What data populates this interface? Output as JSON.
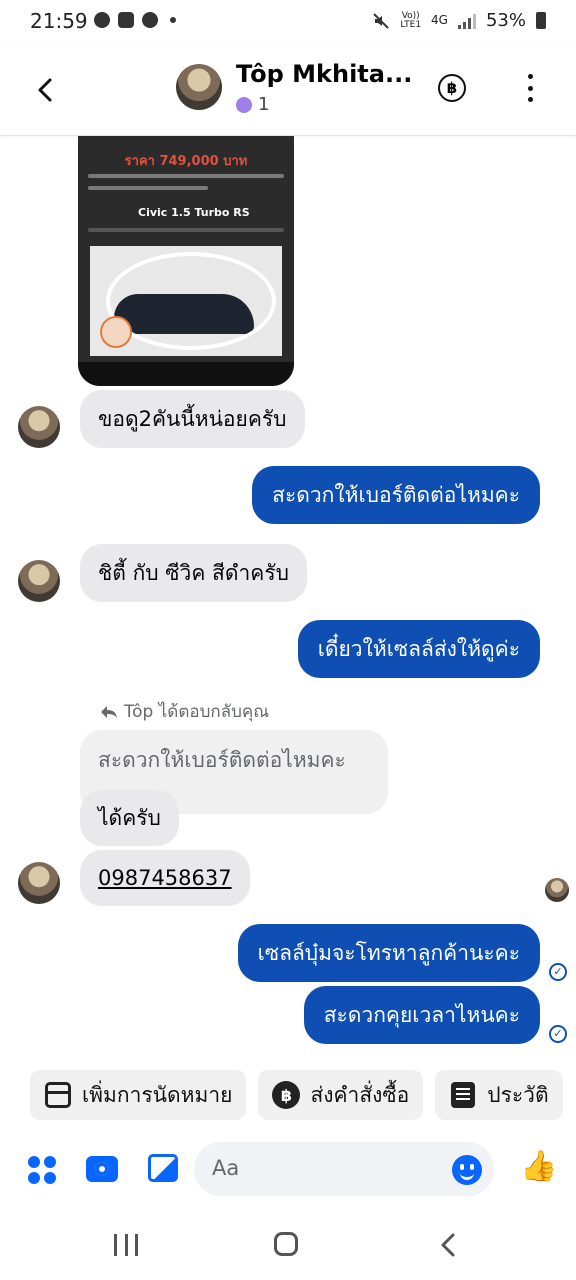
{
  "status_bar": {
    "time": "21:59",
    "volte": "Vo))\nLTE1",
    "network": "4G",
    "battery": "53%"
  },
  "header": {
    "contact_name": "Tôp Mkhita...",
    "sub_count": "1",
    "baht_symbol": "฿"
  },
  "shared_image": {
    "price": "ราคา 749,000 บาท",
    "model": "Civic 1.5 Turbo RS"
  },
  "messages": {
    "m1": "ขอดู2คันนี้หน่อยครับ",
    "m2": "สะดวกให้เบอร์ติดต่อไหมคะ",
    "m3": "ชิตี้ กับ ซีวิค สีดำครับ",
    "m4": "เดี๋ยวให้เซลล์ส่งให้ดูค่ะ",
    "reply_note": "Tôp ได้ตอบกลับคุณ",
    "quoted": "สะดวกให้เบอร์ติดต่อไหมคะ",
    "m5": "ได้ครับ",
    "m6": "0987458637",
    "m7": "เซลล์บุ๋มจะโทรหาลูกค้านะคะ",
    "m8": "สะดวกคุยเวลาไหนคะ"
  },
  "quick_replies": [
    {
      "label": "เพิ่มการนัดหมาย",
      "icon": "calendar-icon"
    },
    {
      "label": "ส่งคำสั่งซื้อ",
      "icon": "baht-icon"
    },
    {
      "label": "ประวัติ",
      "icon": "document-icon"
    }
  ],
  "composer": {
    "placeholder": "Aa"
  },
  "colors": {
    "accent": "#0866ff",
    "outgoing_bubble": "#0f4fb3",
    "incoming_bubble": "#e9e9eb"
  }
}
